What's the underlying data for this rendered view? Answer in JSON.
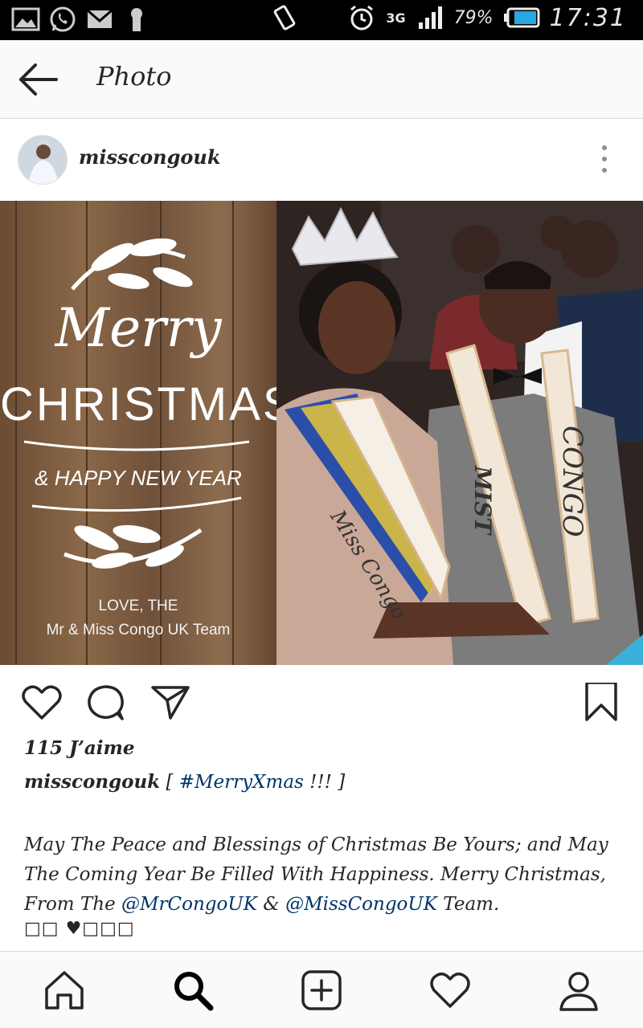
{
  "status_bar": {
    "battery": "79%",
    "network": "3G",
    "time": "17:31",
    "icons": [
      "gallery-icon",
      "whatsapp-icon",
      "gmail-icon",
      "keyhole-icon",
      "vibrate-icon",
      "alarm-icon",
      "signal-icon",
      "battery-icon"
    ]
  },
  "app_bar": {
    "title": "Photo",
    "back_icon": "arrow-left-icon"
  },
  "post": {
    "username": "misscongouk",
    "more_icon": "more-vertical-icon",
    "image": {
      "greeting_line1": "Merry",
      "greeting_line2": "CHRISTMAS",
      "greeting_line3": "& HAPPY NEW YEAR",
      "signoff_line1": "LOVE, THE",
      "signoff_line2": "Mr & Miss Congo UK Team",
      "sash_left": "Miss Congo",
      "sash_right_1": "MIST",
      "sash_right_2": "CONGO"
    },
    "actions": {
      "like_icon": "heart-icon",
      "comment_icon": "comment-icon",
      "share_icon": "send-icon",
      "save_icon": "bookmark-icon"
    },
    "likes": "115 J’aime",
    "caption": {
      "user": "misscongouk",
      "open_bracket": "[",
      "hashtag": "#MerryXmas",
      "tail": "!!! ]",
      "line_part1": "May The Peace and Blessings of Christmas Be Yours; and May The Coming Year Be Filled With Happiness. Merry Christmas, From The",
      "mention1": "@MrCongoUK",
      "amp": "&",
      "mention2": "@MissCongoUK",
      "line_end": "Team.",
      "emojis": "□□ ♥□□□"
    }
  },
  "bottom_nav": {
    "items": [
      "home-icon",
      "search-icon",
      "add-post-icon",
      "activity-heart-icon",
      "profile-icon"
    ]
  },
  "colors": {
    "link": "#003569",
    "text": "#262626",
    "bar_bg": "#fafafa",
    "status_bg": "#000000",
    "wood": "#7a5a3e"
  }
}
